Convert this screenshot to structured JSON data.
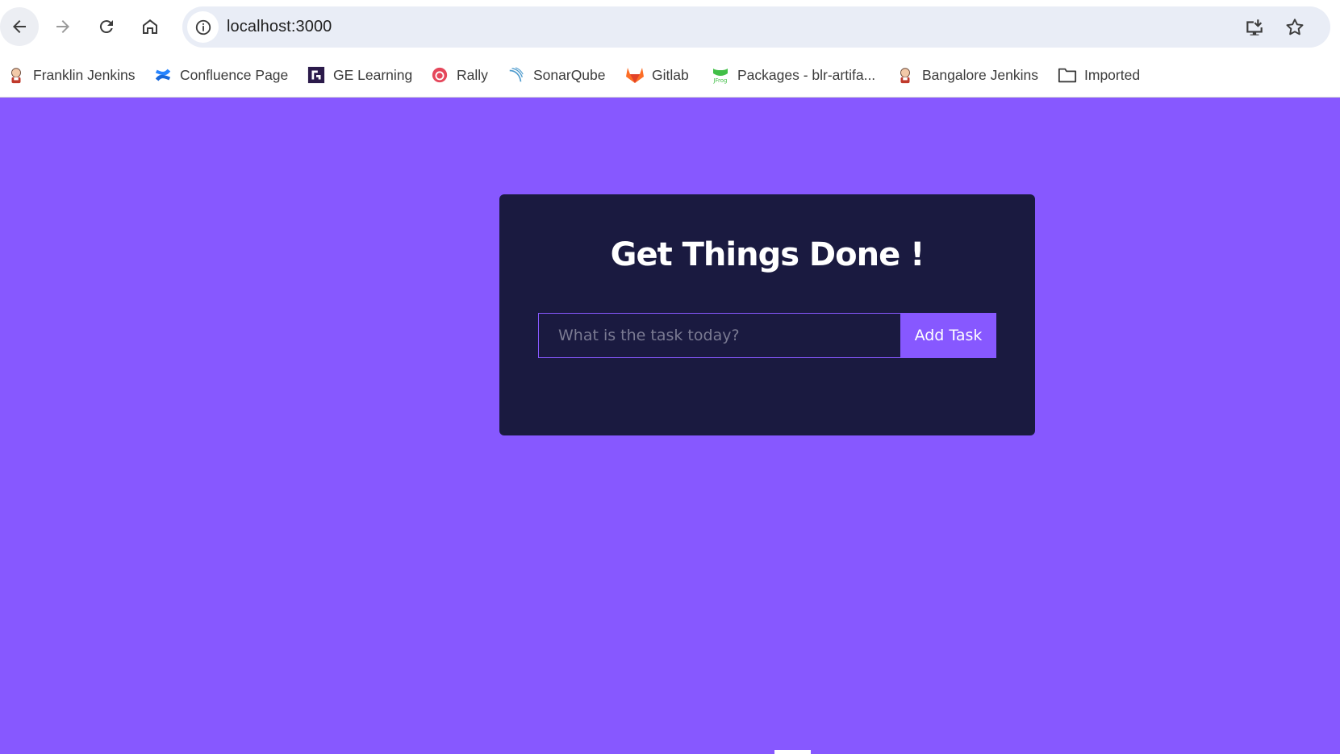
{
  "browser": {
    "url": "localhost:3000",
    "icons": {
      "back": "arrow-left-icon",
      "forward": "arrow-right-icon",
      "reload": "reload-icon",
      "home": "home-icon",
      "site_info": "info-icon",
      "install": "install-app-icon",
      "bookmark": "star-icon"
    }
  },
  "bookmarks": [
    {
      "label": "Franklin Jenkins",
      "icon": "jenkins-icon"
    },
    {
      "label": "Confluence Page",
      "icon": "confluence-icon"
    },
    {
      "label": "GE Learning",
      "icon": "ge-learning-icon"
    },
    {
      "label": "Rally",
      "icon": "rally-icon"
    },
    {
      "label": "SonarQube",
      "icon": "sonarqube-icon"
    },
    {
      "label": "Gitlab",
      "icon": "gitlab-icon"
    },
    {
      "label": "Packages - blr-artifa...",
      "icon": "jfrog-icon"
    },
    {
      "label": "Bangalore Jenkins",
      "icon": "jenkins-icon"
    },
    {
      "label": "Imported",
      "icon": "folder-icon"
    }
  ],
  "app": {
    "title": "Get Things Done !",
    "task_input_placeholder": "What is the task today?",
    "task_input_value": "",
    "add_button_label": "Add Task"
  },
  "colors": {
    "page_background": "#8758ff",
    "card_background": "#1a1a40",
    "accent": "#8758ff"
  }
}
